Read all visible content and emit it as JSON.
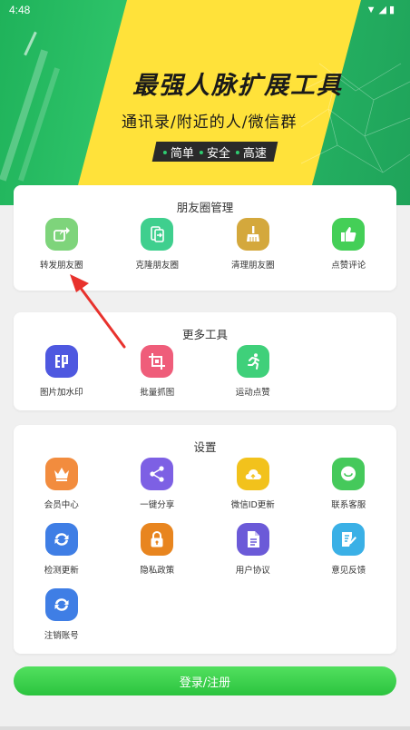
{
  "status": {
    "time": "4:48"
  },
  "banner": {
    "headline": "最强人脉扩展工具",
    "subline": "通讯录/附近的人/微信群",
    "tags": [
      "简单",
      "安全",
      "高速"
    ]
  },
  "sections": {
    "moments": {
      "title": "朋友圈管理",
      "items": [
        {
          "label": "转发朋友圈",
          "icon": "share-forward-icon",
          "color": "#7ed47b"
        },
        {
          "label": "克隆朋友圈",
          "icon": "clone-phone-icon",
          "color": "#3fcf8e"
        },
        {
          "label": "清理朋友圈",
          "icon": "broom-icon",
          "color": "#d4a83c"
        },
        {
          "label": "点赞评论",
          "icon": "thumbs-up-icon",
          "color": "#44cf57"
        }
      ]
    },
    "tools": {
      "title": "更多工具",
      "items": [
        {
          "label": "图片加水印",
          "icon": "watermark-icon",
          "color": "#4e58e0"
        },
        {
          "label": "批量抓图",
          "icon": "crop-icon",
          "color": "#ef5d7a"
        },
        {
          "label": "运动点赞",
          "icon": "running-icon",
          "color": "#3fd07a"
        }
      ]
    },
    "settings": {
      "title": "设置",
      "items": [
        {
          "label": "会员中心",
          "icon": "crown-icon",
          "color": "#f28c3e"
        },
        {
          "label": "一键分享",
          "icon": "share-icon",
          "color": "#7d60e4"
        },
        {
          "label": "微信ID更新",
          "icon": "cloud-refresh-icon",
          "color": "#f2c21c"
        },
        {
          "label": "联系客服",
          "icon": "chat-icon",
          "color": "#45c95b"
        },
        {
          "label": "检测更新",
          "icon": "sync-icon",
          "color": "#3f7ee5"
        },
        {
          "label": "隐私政策",
          "icon": "lock-icon",
          "color": "#e8851f"
        },
        {
          "label": "用户协议",
          "icon": "document-icon",
          "color": "#6b5ad8"
        },
        {
          "label": "意见反馈",
          "icon": "feedback-icon",
          "color": "#3ab0e6"
        },
        {
          "label": "注销账号",
          "icon": "sync-icon",
          "color": "#3f7ee5"
        }
      ]
    }
  },
  "login": {
    "label": "登录/注册"
  }
}
